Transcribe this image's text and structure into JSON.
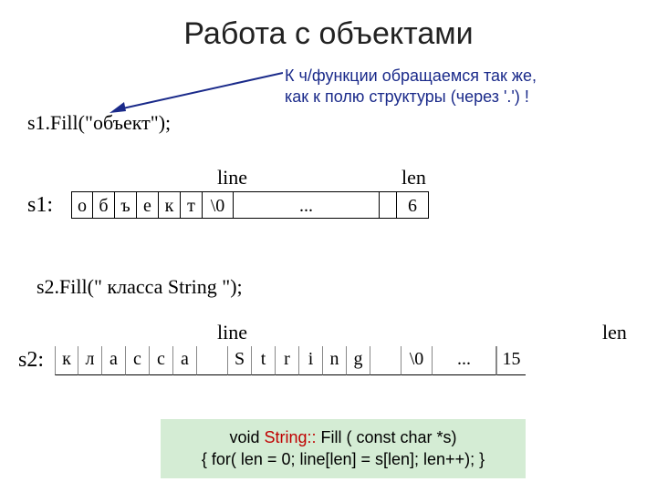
{
  "title": "Работа с объектами",
  "note_line1": "К ч/функции обращаемся так же,",
  "note_line2": "как к полю структуры (через '.') !",
  "call1": "s1.Fill(\"объект\");",
  "call2": "s2.Fill(\" класса String \");",
  "headers": {
    "line": "line",
    "len": "len"
  },
  "s1": {
    "label": "s1:",
    "cells": [
      "о",
      "б",
      "ъ",
      "е",
      "к",
      "т",
      "\\0"
    ],
    "dots": "...",
    "len": "6"
  },
  "s2": {
    "label": "s2:",
    "cells": [
      "к",
      "л",
      "а",
      "с",
      "с",
      "а",
      " ",
      "S",
      "t",
      "r",
      "i",
      "n",
      "g",
      " ",
      "\\0"
    ],
    "dots": "...",
    "len": "15"
  },
  "code": {
    "pre": "void ",
    "kw": "String::",
    "post": " Fill ( const char *s)",
    "line2": "{ for( len = 0; line[len] = s[len]; len++); }"
  }
}
